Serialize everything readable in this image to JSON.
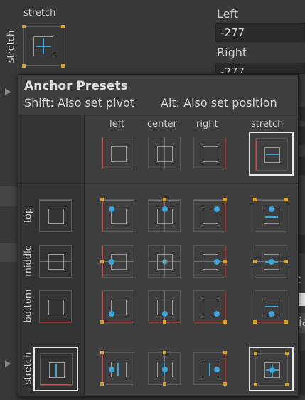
{
  "inspector": {
    "current_anchor_h": "stretch",
    "current_anchor_v": "stretch",
    "left_label": "Left",
    "left_value": "-277",
    "right_label": "Right",
    "right_value": "-277",
    "partial_text_1": "c",
    "partial_text_2": "ria"
  },
  "popup": {
    "title": "Anchor Presets",
    "hint_shift": "Shift: Also set pivot",
    "hint_alt": "Alt: Also set position",
    "columns": [
      "left",
      "center",
      "right",
      "stretch"
    ],
    "rows": [
      "top",
      "middle",
      "bottom",
      "stretch"
    ],
    "selected_horizontal": "stretch",
    "selected_vertical": "stretch"
  },
  "colors": {
    "background": "#383838",
    "popup": "#3e3e3e",
    "anchor_line": "#b9514f",
    "pivot_dot": "#3aa6d8",
    "anchor_square": "#d9a324"
  }
}
